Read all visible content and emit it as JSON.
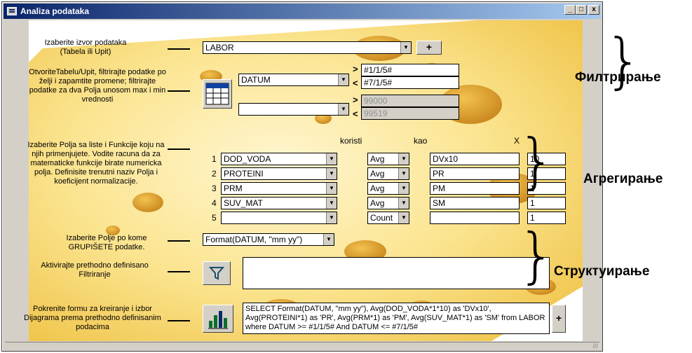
{
  "window": {
    "title": "Analiza podataka",
    "min": "_",
    "max": "□",
    "close": "x"
  },
  "labels": {
    "source": "Izaberite izvor podataka (Tabela ili Upit)",
    "filter": "OtvoriteTabelu/Upit, filtrirajte podatke po želji i zapamtite promene; filtrirajte podatke za dva Polja unosom max i min vrednosti",
    "fields": "Izaberite Polja sa liste i Funkcije koju na njih primenjujete. Vodite racuna da za matematicke funkcije birate numericka polja. Definisite trenutni naziv Polja i koeficijent normalizacije.",
    "group": "Izaberite Polje po kome GRUPIŠETE podatke.",
    "activate": "Aktivirajte prethodno definisano Filtriranje",
    "chart": "Pokrenite formu za kreiranje i izbor Dijagrama prema prethodno definisanim podacima"
  },
  "source": {
    "value": "LABOR",
    "add_label": "+"
  },
  "filter": {
    "field1": "DATUM",
    "gt1": "#1/1/5#",
    "lt1": "#7/1/5#",
    "field2": "",
    "gt2": "99000",
    "lt2": "99519",
    "gt_sym": ">",
    "lt_sym": "<"
  },
  "fields_row_words": {
    "koristi": "koristi",
    "kao": "kao",
    "x": "X"
  },
  "field_rows": [
    {
      "n": "1",
      "field": "DOD_VODA",
      "fn": "Avg",
      "alias": "DVx10",
      "coef": "10"
    },
    {
      "n": "2",
      "field": "PROTEINI",
      "fn": "Avg",
      "alias": "PR",
      "coef": "1"
    },
    {
      "n": "3",
      "field": "PRM",
      "fn": "Avg",
      "alias": "PM",
      "coef": "1"
    },
    {
      "n": "4",
      "field": "SUV_MAT",
      "fn": "Avg",
      "alias": "SM",
      "coef": "1"
    },
    {
      "n": "5",
      "field": "",
      "fn": "Count",
      "alias": "",
      "coef": "1"
    }
  ],
  "group": {
    "value": "Format(DATUM, \"mm yy\")"
  },
  "filter_text": "",
  "sql": "SELECT Format(DATUM, \"mm yy\"), Avg(DOD_VODA*1*10) as 'DVx10', Avg(PROTEINI*1) as 'PR', Avg(PRM*1) as 'PM', Avg(SUV_MAT*1) as 'SM' from LABOR where DATUM >= #1/1/5# And DATUM <= #7/1/5#",
  "sql_add": "+",
  "sections": {
    "filter": "Филтрирање",
    "aggregate": "Агрегирање",
    "structure": "Структуирање"
  },
  "colors": {
    "titlebar": "#0a246a",
    "cheese": "#f6cf5c",
    "hole": "#dca22e"
  }
}
